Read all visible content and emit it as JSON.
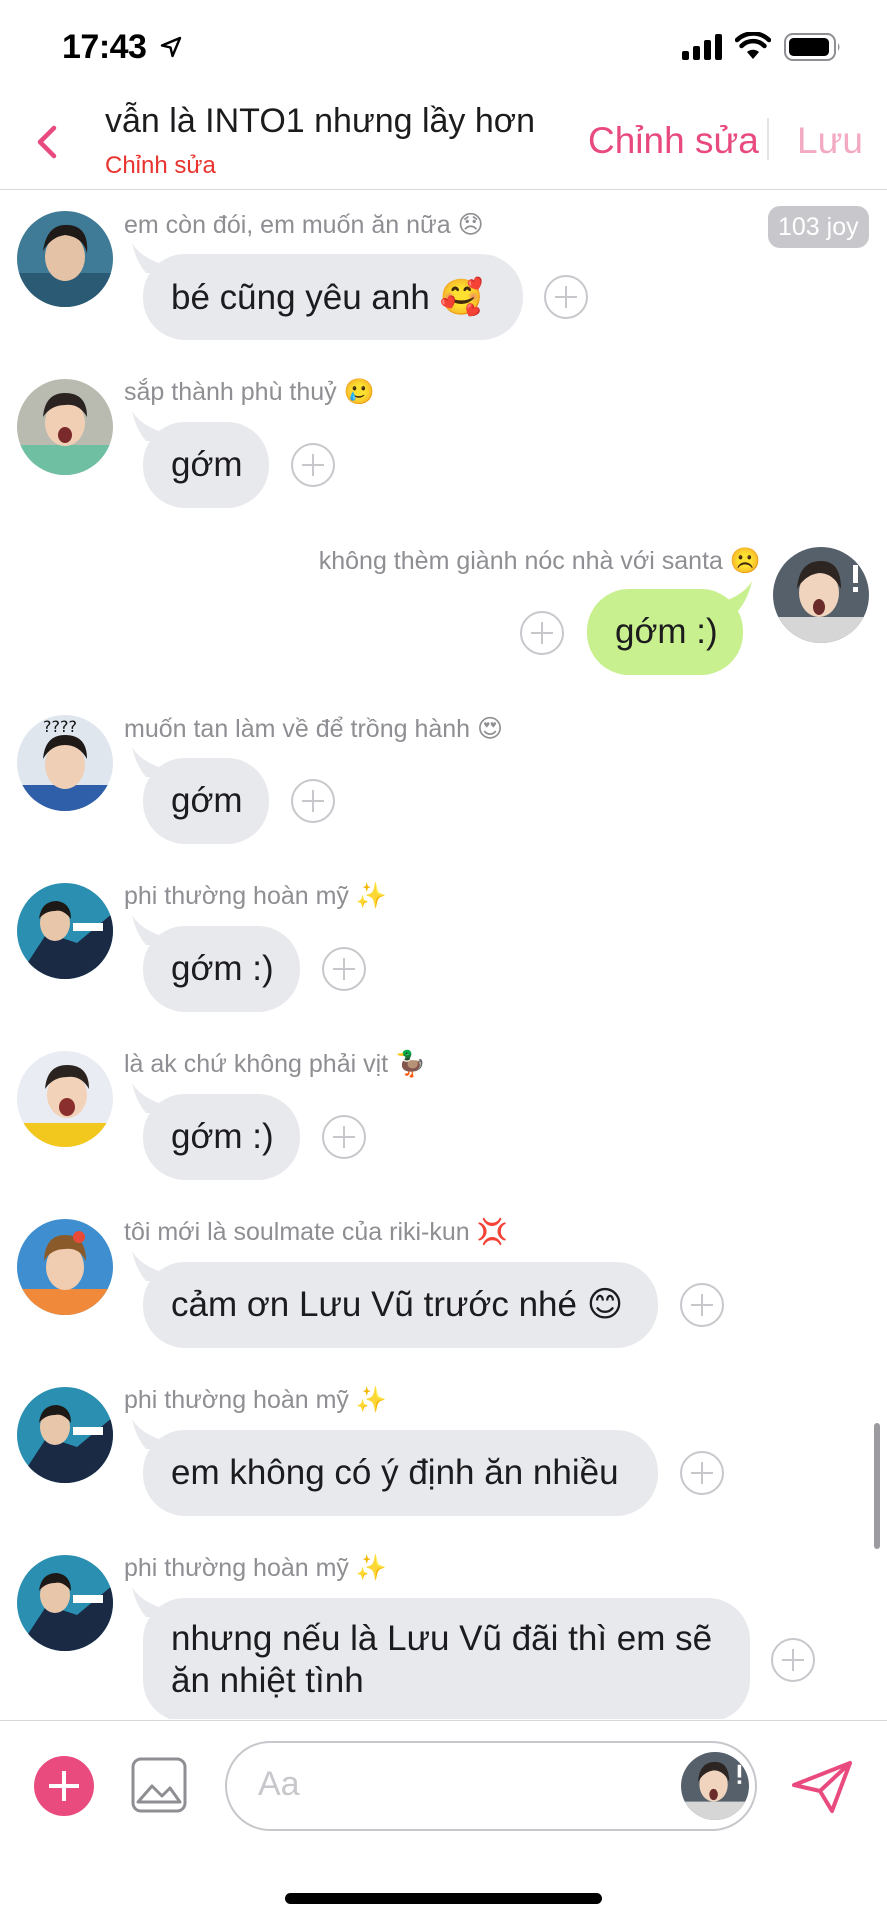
{
  "status_bar": {
    "time": "17:43",
    "icons": [
      "location-arrow-icon",
      "cellular-signal-icon",
      "wifi-icon",
      "battery-icon"
    ]
  },
  "header": {
    "title": "vẫn là INTO1 nhưng lầy hơn",
    "subtitle": "Chỉnh sửa",
    "edit_label": "Chỉnh sửa",
    "save_label": "Lưu",
    "accent_color": "#e84a7f",
    "subtitle_color": "#e8342f"
  },
  "reaction_badge": "103 joy",
  "messages": [
    {
      "direction": "incoming",
      "sender": "em còn đói, em muốn ăn nữa 😞",
      "text": "bé cũng yêu anh 🥰"
    },
    {
      "direction": "incoming",
      "sender": "sắp thành phù thuỷ 🥲",
      "text": "gớm"
    },
    {
      "direction": "outgoing",
      "sender": "không thèm giành nóc nhà với santa ☹️",
      "text": "gớm :)"
    },
    {
      "direction": "incoming",
      "sender": "muốn tan làm về để trồng hành 😍",
      "text": "gớm"
    },
    {
      "direction": "incoming",
      "sender": "phi thường hoàn mỹ ✨",
      "text": "gớm :)"
    },
    {
      "direction": "incoming",
      "sender": "là ak chứ không phải vịt 🦆",
      "text": "gớm :)"
    },
    {
      "direction": "incoming",
      "sender": "tôi mới là soulmate của riki-kun 💢",
      "text": "cảm ơn Lưu Vũ trước nhé 😊"
    },
    {
      "direction": "incoming",
      "sender": "phi thường hoàn mỹ ✨",
      "text": "em không có ý định ăn nhiều"
    },
    {
      "direction": "incoming",
      "sender": "phi thường hoàn mỹ ✨",
      "text": "nhưng nếu là Lưu Vũ đãi thì em sẽ ăn nhiệt tình"
    }
  ],
  "composer": {
    "placeholder": "Aa",
    "icons": [
      "add-icon",
      "image-icon",
      "send-icon"
    ],
    "accent_color": "#ea4b7e"
  },
  "colors": {
    "incoming_bubble": "#e8e9ed",
    "outgoing_bubble": "#c9f08e"
  }
}
